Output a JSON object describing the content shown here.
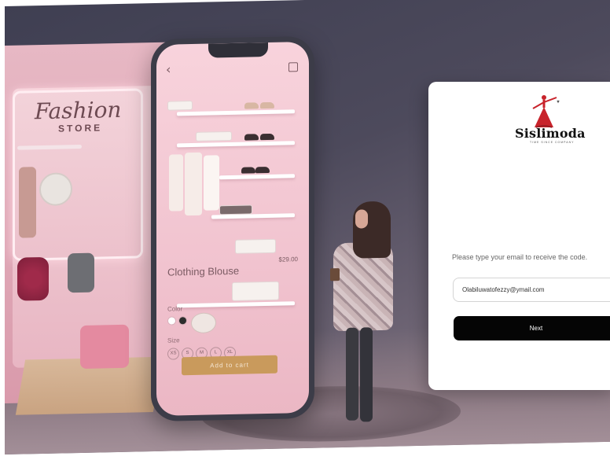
{
  "hero": {
    "sign_title": "Fashion",
    "sign_subtitle": "STORE",
    "product": {
      "title": "Clothing Blouse",
      "price": "$29.00",
      "color_label": "Color",
      "size_label": "Size",
      "sizes": [
        "XS",
        "S",
        "M",
        "L",
        "XL"
      ],
      "add_to_cart": "Add to cart"
    }
  },
  "login": {
    "brand": "Sislimoda",
    "tagline": "TIME SINCE COMPANY",
    "prompt": "Please type your email to receive the code.",
    "email_value": "Olabiluwatofezzy@ymail.com",
    "next_label": "Next"
  },
  "colors": {
    "card": "#ffffff",
    "button": "#050505",
    "logo_red": "#c8232b",
    "add_to_cart": "#c99a5c"
  }
}
